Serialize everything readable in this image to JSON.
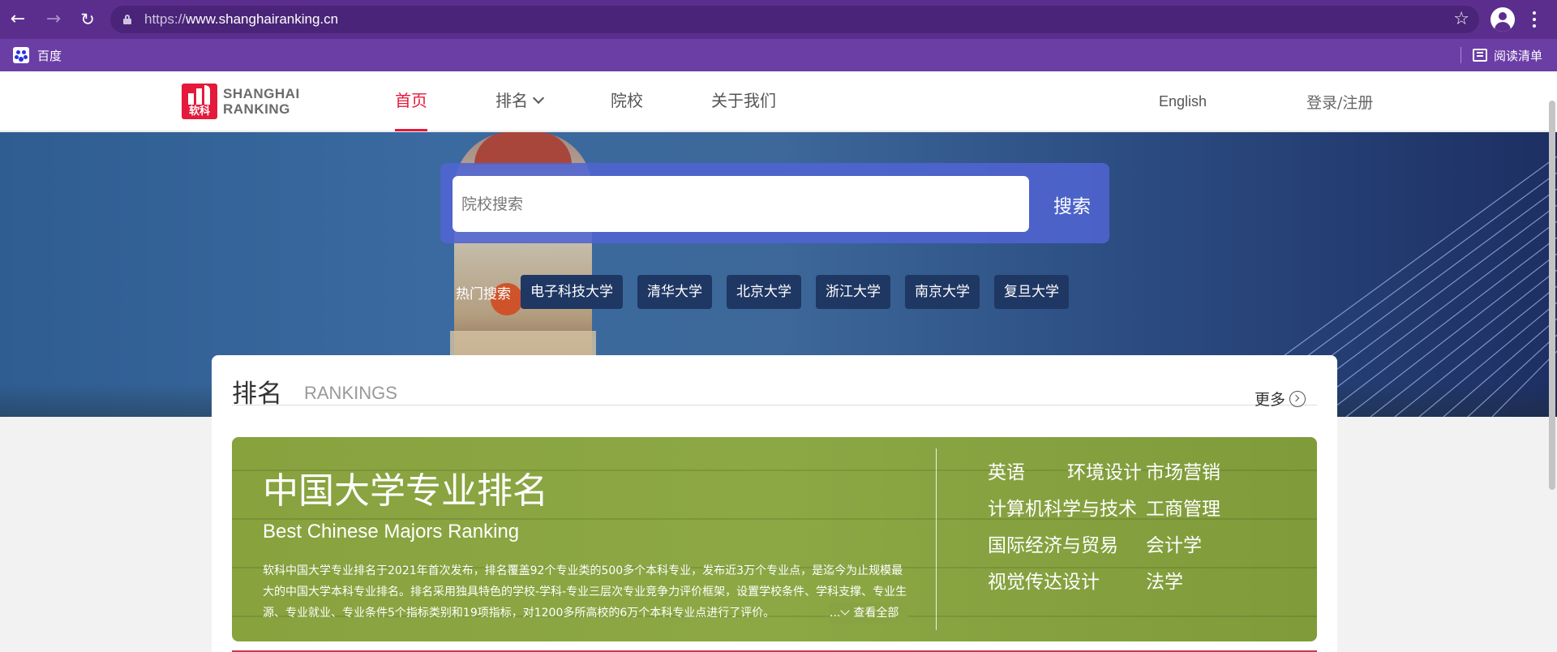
{
  "browser": {
    "url_scheme": "https://",
    "url_host": "www.shanghairanking.cn",
    "bookmarks": [
      {
        "label": "百度",
        "icon": "baidu-paw-icon"
      }
    ],
    "reading_list_label": "阅读清单",
    "colors": {
      "toolbar": "#5b2e8e",
      "bookmark_bar": "#6b3ea6"
    }
  },
  "header": {
    "logo_mark_text": "软科",
    "logo_line1": "SHANGHAI",
    "logo_line2": "RANKING",
    "nav": [
      {
        "label": "首页",
        "active": true
      },
      {
        "label": "排名",
        "has_dropdown": true
      },
      {
        "label": "院校"
      },
      {
        "label": "关于我们"
      }
    ],
    "language_link": "English",
    "login_link": "登录/注册",
    "colors": {
      "accent": "#e4193b"
    }
  },
  "hero": {
    "search": {
      "placeholder": "院校搜索",
      "button_label": "搜索"
    },
    "hot_search_label": "热门搜索",
    "hot_tags": [
      "电子科技大学",
      "清华大学",
      "北京大学",
      "浙江大学",
      "南京大学",
      "复旦大学"
    ]
  },
  "rankings": {
    "title": "排名",
    "subtitle": "RANKINGS",
    "more_label": "更多",
    "feature": {
      "title": "中国大学专业排名",
      "title_en": "Best Chinese Majors Ranking",
      "description": "软科中国大学专业排名于2021年首次发布，排名覆盖92个专业类的500多个本科专业，发布近3万个专业点，是迄今为止规模最大的中国大学本科专业排名。排名采用独具特色的学校-学科-专业三层次专业竞争力评价框架，设置学校条件、学科支撑、专业生源、专业就业、专业条件5个指标类别和19项指标，对1200多所高校的6万个本科专业点进行了评价。",
      "view_all_label": "查看全部",
      "majors": [
        "英语",
        "环境设计",
        "市场营销",
        "计算机科学与技术",
        "工商管理",
        "国际经济与贸易",
        "会计学",
        "视觉传达设计",
        "法学"
      ],
      "color": "#88a23e"
    }
  }
}
